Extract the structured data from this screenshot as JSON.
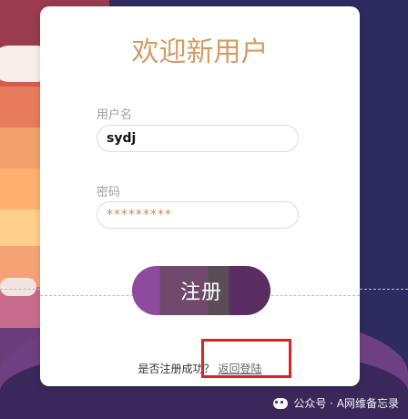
{
  "form": {
    "title": "欢迎新用户",
    "username_label": "用户名",
    "username_value": "sydj",
    "password_label": "密码",
    "password_value": "*********",
    "register_button": "注册",
    "footer_prompt": "是否注册成功？",
    "footer_link": "返回登陆"
  },
  "watermark": {
    "text": "公众号 · A网维备忘录"
  },
  "colors": {
    "title": "#d49b63",
    "highlight": "#d62525"
  }
}
